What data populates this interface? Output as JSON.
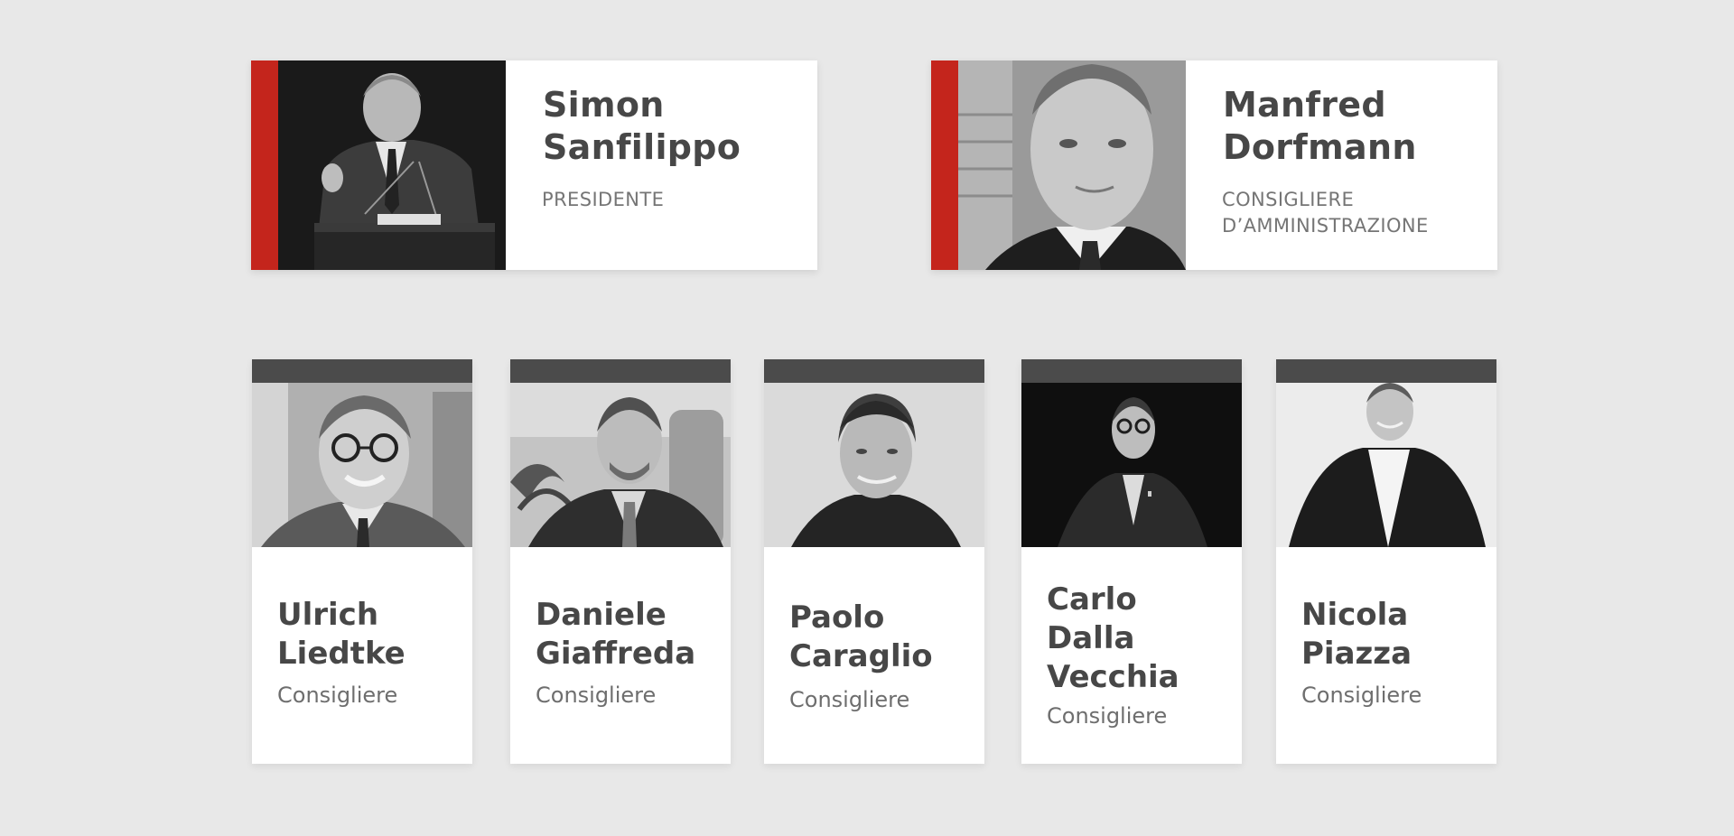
{
  "leadership": [
    {
      "name_line1": "Simon",
      "name_line2": "Sanfilippo",
      "role_line1": "PRESIDENTE",
      "role_line2": "",
      "photo_icon": "portrait-speaker-at-podium",
      "accent_color": "#c4251c"
    },
    {
      "name_line1": "Manfred",
      "name_line2": "Dorfmann",
      "role_line1": "CONSIGLIERE",
      "role_line2": "D’AMMINISTRAZIONE",
      "photo_icon": "portrait-headshot",
      "accent_color": "#c4251c"
    }
  ],
  "council": [
    {
      "name_line1": "Ulrich",
      "name_line2": "Liedtke",
      "name_line3": "",
      "role": "Consigliere",
      "photo_icon": "portrait-glasses"
    },
    {
      "name_line1": "Daniele",
      "name_line2": "Giaffreda",
      "name_line3": "",
      "role": "Consigliere",
      "photo_icon": "portrait-seated"
    },
    {
      "name_line1": "Paolo",
      "name_line2": "Caraglio",
      "name_line3": "",
      "role": "Consigliere",
      "photo_icon": "portrait-sweater"
    },
    {
      "name_line1": "Carlo",
      "name_line2": "Dalla",
      "name_line3": "Vecchia",
      "role": "Consigliere",
      "photo_icon": "portrait-dark-background"
    },
    {
      "name_line1": "Nicola",
      "name_line2": "Piazza",
      "name_line3": "",
      "role": "Consigliere",
      "photo_icon": "portrait-light-background"
    }
  ],
  "colors": {
    "background": "#e8e8e8",
    "card": "#ffffff",
    "accent_red": "#c4251c",
    "bar_dark": "#4b4b4b",
    "text_dark": "#474747",
    "text_muted": "#757575"
  }
}
